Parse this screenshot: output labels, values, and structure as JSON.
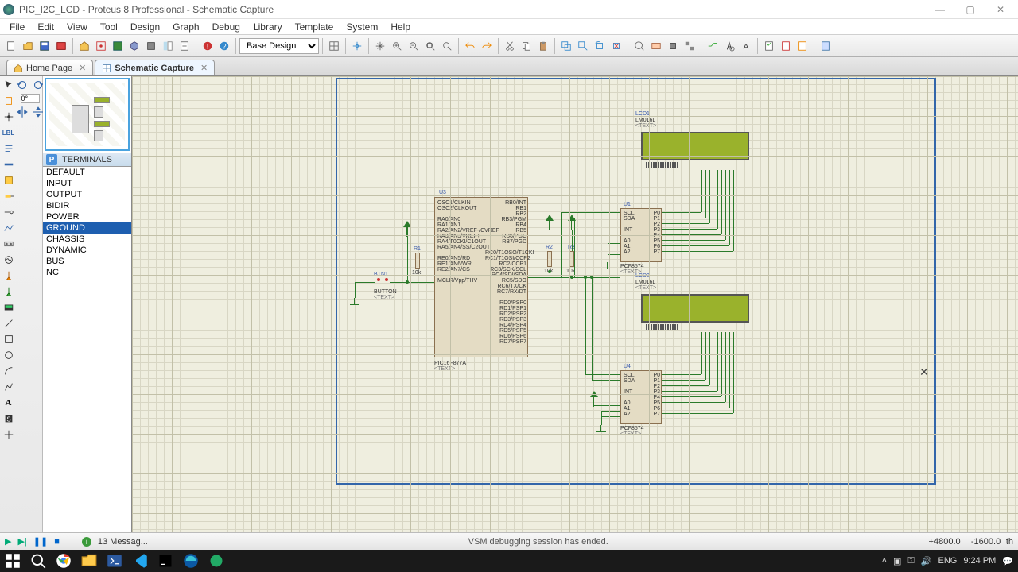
{
  "window": {
    "title": "PIC_I2C_LCD - Proteus 8 Professional - Schematic Capture"
  },
  "menu": {
    "items": [
      "File",
      "Edit",
      "View",
      "Tool",
      "Design",
      "Graph",
      "Debug",
      "Library",
      "Template",
      "System",
      "Help"
    ]
  },
  "toolbar": {
    "combo": "Base Design"
  },
  "tabs": {
    "home": "Home Page",
    "active": "Schematic Capture"
  },
  "rotation": "0°",
  "terminals": {
    "header": "TERMINALS",
    "items": [
      "DEFAULT",
      "INPUT",
      "OUTPUT",
      "BIDIR",
      "POWER",
      "GROUND",
      "CHASSIS",
      "DYNAMIC",
      "BUS",
      "NC"
    ],
    "selected": "GROUND"
  },
  "schematic": {
    "u3": {
      "ref": "U3",
      "part": "PIC16F877A",
      "left_pins": [
        "OSC1/CLKIN",
        "OSC2/CLKOUT",
        "RA0/AN0",
        "RA1/AN1",
        "RA2/AN2/VREF-/CVREF",
        "RA3/AN3/VREF+",
        "RA4/T0CKI/C1OUT",
        "RA5/AN4/SS/C2OUT",
        "RE0/AN5/RD",
        "RE1/AN6/WR",
        "RE2/AN7/CS",
        "MCLR/Vpp/THV"
      ],
      "right_pins": [
        "RB0/INT",
        "RB1",
        "RB2",
        "RB3/PGM",
        "RB4",
        "RB5",
        "RB6/PGC",
        "RB7/PGD",
        "RC0/T1OSO/T1CKI",
        "RC1/T1OSI/CCP2",
        "RC2/CCP1",
        "RC3/SCK/SCL",
        "RC4/SDI/SDA",
        "RC5/SDO",
        "RC6/TX/CK",
        "RC7/RX/DT",
        "RD0/PSP0",
        "RD1/PSP1",
        "RD2/PSP2",
        "RD3/PSP3",
        "RD4/PSP4",
        "RD5/PSP5",
        "RD6/PSP6",
        "RD7/PSP7"
      ]
    },
    "u1": {
      "ref": "U1",
      "part": "PCF8574"
    },
    "u4": {
      "ref": "U4",
      "part": "PCF8574"
    },
    "lcd1": {
      "ref": "LCD1",
      "part": "LM016L"
    },
    "lcd2": {
      "ref": "LCD2",
      "part": "LM016L"
    },
    "btn": {
      "ref": "BTN1",
      "part": "BUTTON"
    },
    "r1": {
      "ref": "R1",
      "val": "10k"
    },
    "r2": {
      "ref": "R2",
      "val": "10k"
    },
    "r3": {
      "ref": "R3",
      "val": "10k"
    },
    "pcf_left": [
      "SCL",
      "SDA",
      "INT",
      "A0",
      "A1",
      "A2"
    ],
    "pcf_right": [
      "P0",
      "P1",
      "P2",
      "P3",
      "P4",
      "P5",
      "P6",
      "P7"
    ],
    "text_stub": "<TEXT>"
  },
  "controlbar": {
    "messages": "13 Messag...",
    "status": "VSM debugging session has ended.",
    "coord_x": "+4800.0",
    "coord_y": "-1600.0",
    "unit": "th"
  },
  "taskbar": {
    "lang": "ENG",
    "time": "9:24 PM"
  }
}
